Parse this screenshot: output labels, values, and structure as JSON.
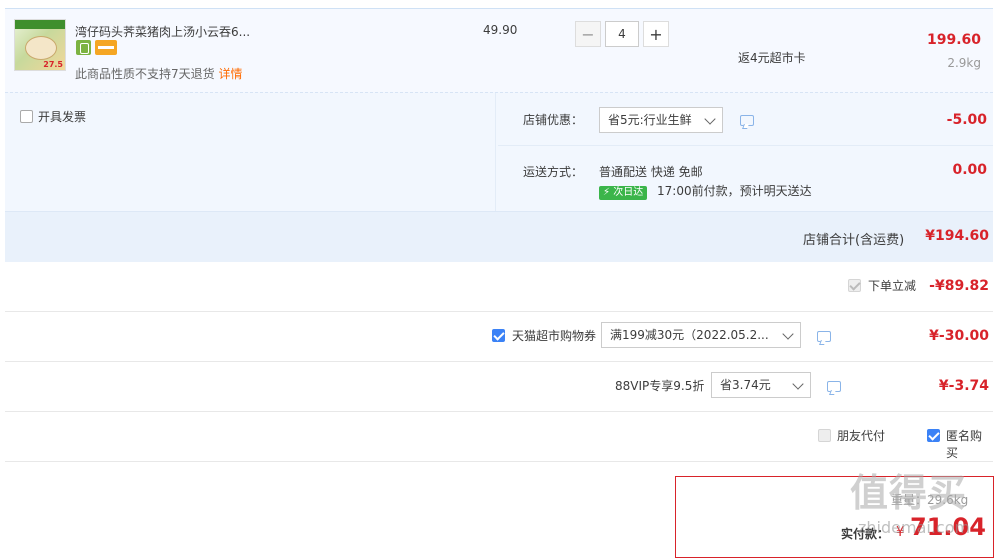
{
  "item": {
    "title": "湾仔码头荠菜猪肉上汤小云吞6...",
    "thumb_price": "27.5",
    "notice_text": "此商品性质不支持7天退货",
    "notice_link": "详情",
    "unit_price": "49.90",
    "quantity": "4",
    "minus": "−",
    "plus": "+",
    "promo": "返4元超市卡",
    "subtotal": "199.60",
    "weight": "2.9kg"
  },
  "invoice": {
    "label": "开具发票"
  },
  "store_discount": {
    "label": "店铺优惠：",
    "selected": "省5元:行业生鲜",
    "amount": "-5.00"
  },
  "shipping": {
    "label": "运送方式：",
    "method": "普通配送 快递 免邮",
    "badge": "次日达",
    "note": "17:00前付款，预计明天送达",
    "amount": "0.00"
  },
  "store_total": {
    "label": "店铺合计(含运费)",
    "amount": "¥194.60"
  },
  "instant_discount": {
    "label": "下单立减",
    "amount": "-¥89.82"
  },
  "coupon": {
    "label": "天猫超市购物券",
    "selected": "满199减30元（2022.05.2...",
    "amount": "¥-30.00"
  },
  "vip": {
    "label": "88VIP专享9.5折",
    "selected": "省3.74元",
    "amount": "¥-3.74"
  },
  "options": {
    "friend_pay": "朋友代付",
    "anonymous": "匿名购买"
  },
  "payment": {
    "label": "实付款：",
    "currency": "¥",
    "amount": "71.04",
    "partial_label": "重量：",
    "partial_value": "29.6kg"
  },
  "watermark": {
    "main": "值得买",
    "sub": "zhidemai.com"
  },
  "colors": {
    "accent_red": "#d8232a",
    "check_blue": "#3b82f6",
    "row_bg": "#f2f7fe"
  }
}
